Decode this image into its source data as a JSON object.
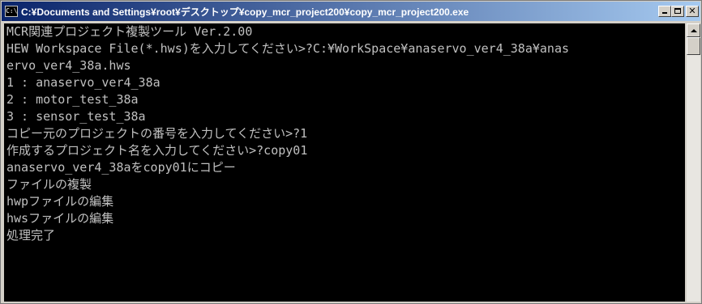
{
  "window": {
    "title": "C:¥Documents and Settings¥root¥デスクトップ¥copy_mcr_project200¥copy_mcr_project200.exe",
    "icon_label": "C:\\",
    "minimize_icon": "minimize-icon",
    "maximize_icon": "maximize-icon",
    "close_icon": "close-icon"
  },
  "console": {
    "background": "#000000",
    "text_color": "#c0c0c0",
    "lines": [
      "MCR関連プロジェクト複製ツール Ver.2.00",
      "HEW Workspace File(*.hws)を入力してください>?C:¥WorkSpace¥anaservo_ver4_38a¥anas",
      "ervo_ver4_38a.hws",
      "1 : anaservo_ver4_38a",
      "2 : motor_test_38a",
      "3 : sensor_test_38a",
      "コピー元のプロジェクトの番号を入力してください>?1",
      "作成するプロジェクト名を入力してください>?copy01",
      "anaservo_ver4_38aをcopy01にコピー",
      "ファイルの複製",
      "hwpファイルの編集",
      "hwsファイルの編集",
      "処理完了"
    ]
  },
  "colors": {
    "titlebar_start": "#0a246a",
    "titlebar_end": "#a6caf0",
    "frame": "#d4d0c8"
  }
}
